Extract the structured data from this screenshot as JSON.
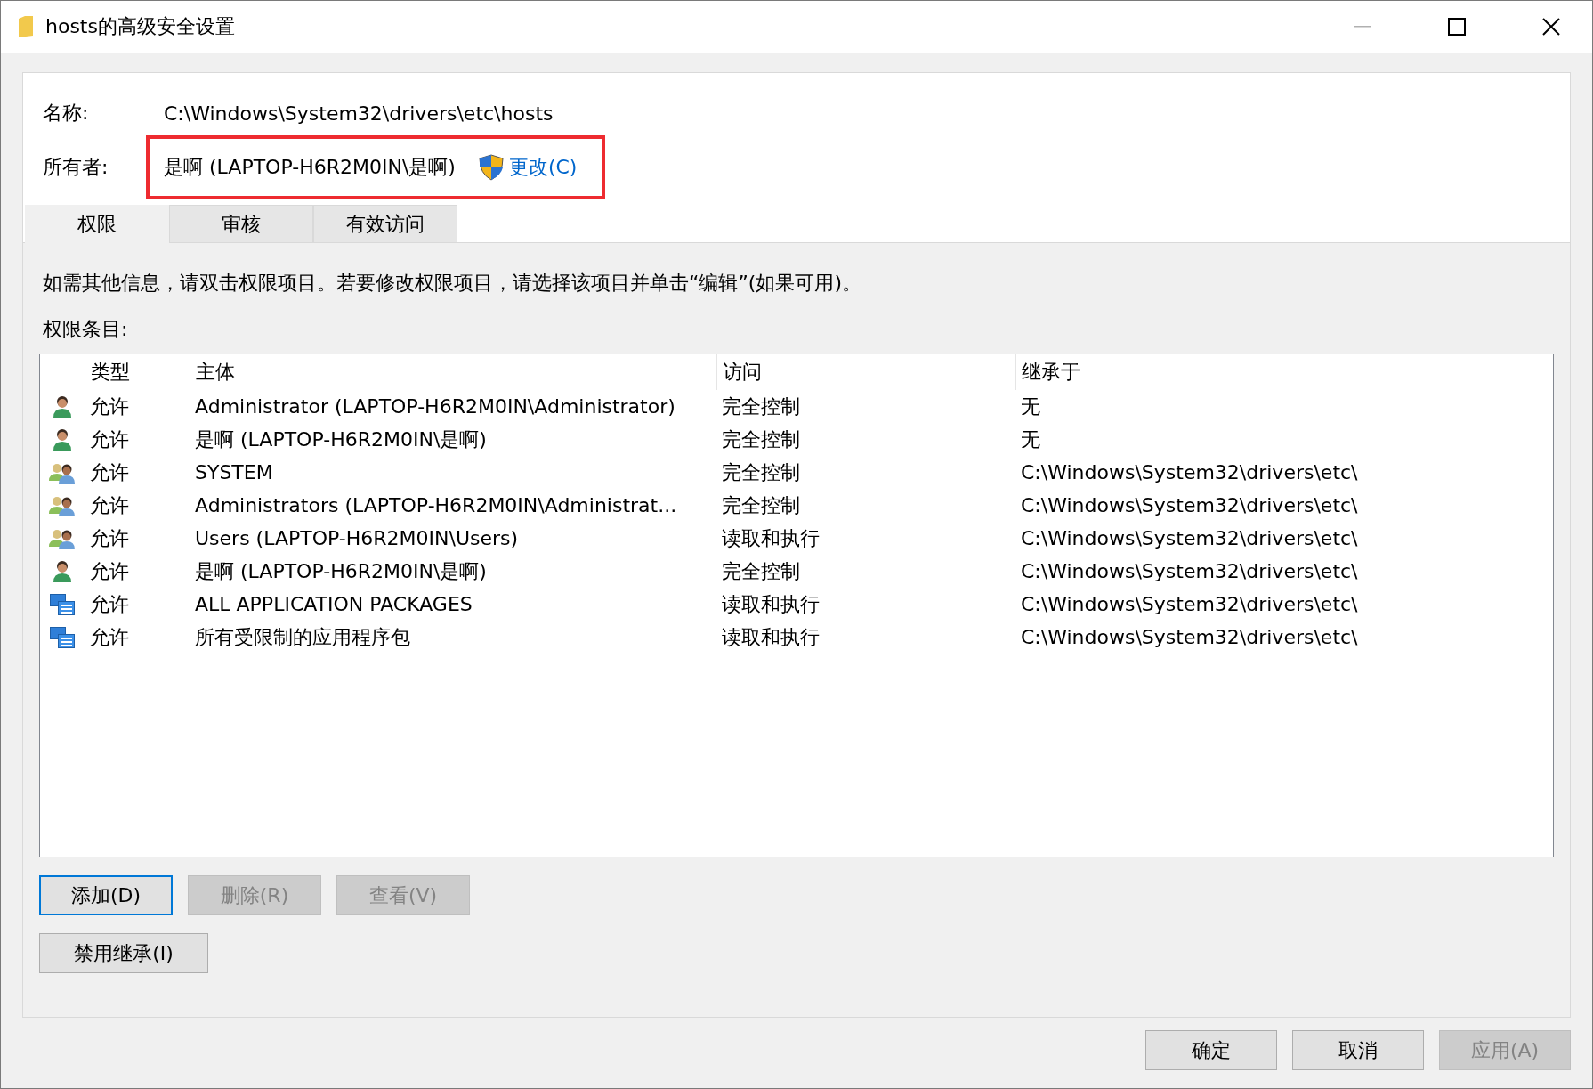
{
  "window": {
    "title": "hosts的高级安全设置"
  },
  "name_field": {
    "label": "名称:",
    "value": "C:\\Windows\\System32\\drivers\\etc\\hosts"
  },
  "owner_field": {
    "label": "所有者:",
    "value": "是啊 (LAPTOP-H6R2M0IN\\是啊)",
    "link": "更改(C)",
    "highlighted": true
  },
  "tabs": [
    {
      "label": "权限",
      "selected": true
    },
    {
      "label": "审核",
      "selected": false
    },
    {
      "label": "有效访问",
      "selected": false
    }
  ],
  "instruction": "如需其他信息，请双击权限项目。若要修改权限项目，请选择该项目并单击“编辑”(如果可用)。",
  "entries_label": "权限条目:",
  "table": {
    "columns": [
      "类型",
      "主体",
      "访问",
      "继承于"
    ],
    "rows": [
      {
        "kind": "user",
        "type": "允许",
        "principal": "Administrator (LAPTOP-H6R2M0IN\\Administrator)",
        "access": "完全控制",
        "inherited_from": "无"
      },
      {
        "kind": "user",
        "type": "允许",
        "principal": "是啊 (LAPTOP-H6R2M0IN\\是啊)",
        "access": "完全控制",
        "inherited_from": "无"
      },
      {
        "kind": "group",
        "type": "允许",
        "principal": "SYSTEM",
        "access": "完全控制",
        "inherited_from": "C:\\Windows\\System32\\drivers\\etc\\"
      },
      {
        "kind": "group",
        "type": "允许",
        "principal": "Administrators (LAPTOP-H6R2M0IN\\Administrat...",
        "access": "完全控制",
        "inherited_from": "C:\\Windows\\System32\\drivers\\etc\\"
      },
      {
        "kind": "group",
        "type": "允许",
        "principal": "Users (LAPTOP-H6R2M0IN\\Users)",
        "access": "读取和执行",
        "inherited_from": "C:\\Windows\\System32\\drivers\\etc\\"
      },
      {
        "kind": "user",
        "type": "允许",
        "principal": "是啊 (LAPTOP-H6R2M0IN\\是啊)",
        "access": "完全控制",
        "inherited_from": "C:\\Windows\\System32\\drivers\\etc\\"
      },
      {
        "kind": "package",
        "type": "允许",
        "principal": "ALL APPLICATION PACKAGES",
        "access": "读取和执行",
        "inherited_from": "C:\\Windows\\System32\\drivers\\etc\\"
      },
      {
        "kind": "package",
        "type": "允许",
        "principal": "所有受限制的应用程序包",
        "access": "读取和执行",
        "inherited_from": "C:\\Windows\\System32\\drivers\\etc\\"
      }
    ]
  },
  "entry_buttons": [
    {
      "label": "添加(D)",
      "disabled": false,
      "focused": true
    },
    {
      "label": "删除(R)",
      "disabled": true,
      "focused": false
    },
    {
      "label": "查看(V)",
      "disabled": true,
      "focused": false
    }
  ],
  "inheritance_button": {
    "label": "禁用继承(I)",
    "disabled": false
  },
  "dialog_buttons": [
    {
      "label": "确定",
      "disabled": false
    },
    {
      "label": "取消",
      "disabled": false
    },
    {
      "label": "应用(A)",
      "disabled": true
    }
  ]
}
